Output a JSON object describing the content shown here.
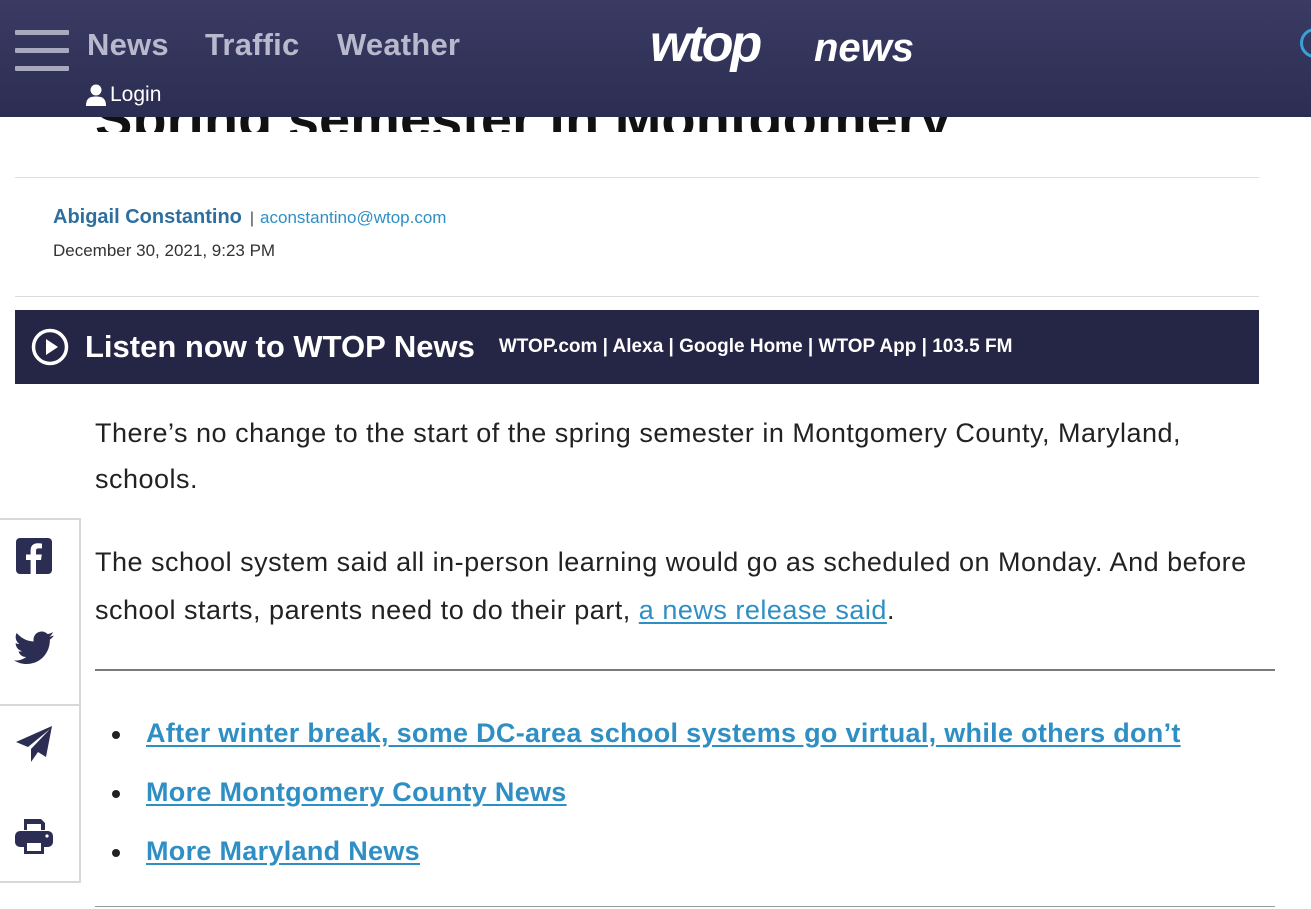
{
  "header": {
    "nav": [
      "News",
      "Traffic",
      "Weather"
    ],
    "login_label": "Login",
    "logo": {
      "bold": "wtop",
      "light": "news"
    }
  },
  "article": {
    "headline_peek": "Spring semester in Montgomery",
    "author": "Abigail Constantino",
    "separator": "|",
    "email": "aconstantino@wtop.com",
    "date": "December 30, 2021, 9:23 PM",
    "p1": "There’s no change to the start of the spring semester in Montgomery County, Maryland, schools.",
    "p2_text": "The school system said all in-person learning would go as scheduled on Monday. And before school starts, parents need to do their part, ",
    "p2_link": "a news release said",
    "p2_end": "."
  },
  "listen": {
    "title": "Listen now to WTOP News",
    "links": "WTOP.com | Alexa | Google Home | WTOP App | 103.5 FM"
  },
  "related": [
    "After winter break, some DC-area school systems go virtual, while others don’t",
    "More Montgomery County News",
    "More Maryland News"
  ],
  "share": [
    "facebook-icon",
    "twitter-icon",
    "send-icon",
    "print-icon"
  ],
  "colors": {
    "header_bg": "#2c2d52",
    "banner_bg": "#252545",
    "link": "#2f8fc4",
    "author": "#2f6f9f"
  }
}
